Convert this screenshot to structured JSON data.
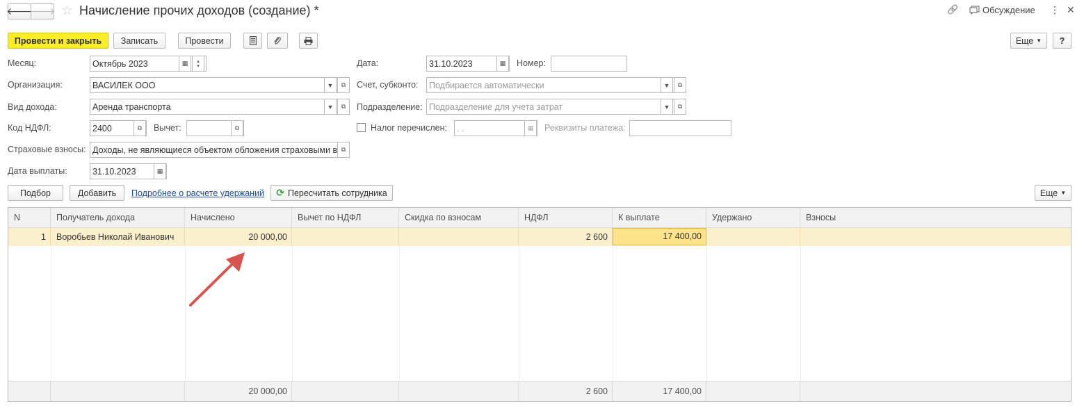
{
  "header": {
    "back_glyph": "🡐",
    "forward_glyph": "🡒",
    "star_glyph": "☆",
    "title": "Начисление прочих доходов (создание) *",
    "link_glyph": "🔗",
    "discussion_label": "Обсуждение",
    "more_glyph": "⋮",
    "close_glyph": "✕"
  },
  "toolbar": {
    "post_close": "Провести и закрыть",
    "save": "Записать",
    "post": "Провести",
    "more": "Еще",
    "help": "?"
  },
  "form": {
    "month_label": "Месяц:",
    "month_value": "Октябрь 2023",
    "date_label": "Дата:",
    "date_value": "31.10.2023",
    "number_label": "Номер:",
    "number_value": "",
    "org_label": "Организация:",
    "org_value": "ВАСИЛЕК ООО",
    "account_label": "Счет, субконто:",
    "account_placeholder": "Подбирается автоматически",
    "income_type_label": "Вид дохода:",
    "income_type_value": "Аренда транспорта",
    "department_label": "Подразделение:",
    "department_placeholder": "Подразделение для учета затрат",
    "ndfl_code_label": "Код НДФЛ:",
    "ndfl_code_value": "2400",
    "deduction_label": "Вычет:",
    "deduction_value": "",
    "tax_transferred_label": "Налог перечислен:",
    "tax_transferred_date": " .  .",
    "payment_details_label": "Реквизиты платежа:",
    "payment_details_value": "",
    "insurance_label": "Страховые взносы:",
    "insurance_value": "Доходы, не являющиеся объектом обложения страховыми вз",
    "payment_date_label": "Дата выплаты:",
    "payment_date_value": "31.10.2023"
  },
  "table_toolbar": {
    "select": "Подбор",
    "add": "Добавить",
    "details_link": "Подробнее о расчете удержаний",
    "recalc": "Пересчитать сотрудника",
    "more": "Еще"
  },
  "table": {
    "columns": [
      "N",
      "Получатель дохода",
      "Начислено",
      "Вычет по НДФЛ",
      "Скидка по взносам",
      "НДФЛ",
      "К выплате",
      "Удержано",
      "Взносы"
    ],
    "rows": [
      {
        "n": "1",
        "recipient": "Воробьев Николай Иванович",
        "accrued": "20 000,00",
        "deduction": "",
        "discount": "",
        "ndfl": "2 600",
        "payout": "17 400,00",
        "withheld": "",
        "contributions": ""
      }
    ],
    "totals": {
      "accrued": "20 000,00",
      "ndfl": "2 600",
      "payout": "17 400,00"
    }
  },
  "colors": {
    "accent_yellow": "#fbed26",
    "row_highlight": "#fbf0cc",
    "selected_cell": "#fde38a",
    "arrow": "#d9534f",
    "link": "#1c4c9c"
  }
}
